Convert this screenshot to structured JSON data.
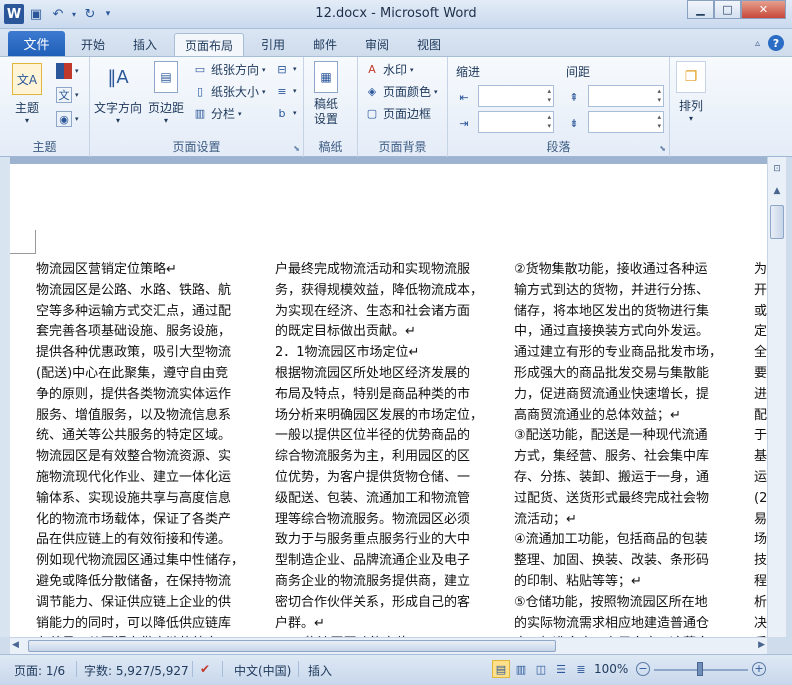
{
  "titlebar": {
    "title": "12.docx - Microsoft Word"
  },
  "tabs": {
    "file": "文件",
    "items": [
      "开始",
      "插入",
      "页面布局",
      "引用",
      "邮件",
      "审阅",
      "视图"
    ],
    "active": "页面布局"
  },
  "ribbon": {
    "theme": {
      "label": "主题",
      "theme_btn": "主题"
    },
    "page_setup": {
      "label": "页面设置",
      "text_direction": "文字方向",
      "margins": "页边距",
      "paper_orientation": "纸张方向",
      "paper_size": "纸张大小",
      "columns": "分栏"
    },
    "manuscript": {
      "label": "稿纸",
      "manuscript_setting": "稿纸\n设置",
      "line1": "稿纸",
      "line2": "设置"
    },
    "page_bg": {
      "label": "页面背景",
      "watermark": "水印",
      "page_color": "页面颜色",
      "page_border": "页面边框"
    },
    "paragraph": {
      "label": "段落",
      "indent": "缩进",
      "spacing": "间距"
    },
    "arrange": {
      "label": "排列",
      "arrange_btn": "排列"
    }
  },
  "document": {
    "col1": [
      "物流园区营销定位策略↵",
      "物流园区是公路、水路、铁路、航",
      "空等多种运输方式交汇点，通过配",
      "套完善各项基础设施、服务设施，",
      "提供各种优惠政策，吸引大型物流",
      "(配送)中心在此聚集，遵守自由竞",
      "争的原则，提供各类物流实体运作",
      "服务、增值服务，以及物流信息系",
      "统、通关等公共服务的特定区域。",
      "物流园区是有效整合物流资源、实",
      "施物流现代化作业、建立一体化运",
      "输体系、实现设施共享与高度信息",
      "化的物流市场载体，保证了各类产",
      "品在供应链上的有效衔接和传递。",
      "例如现代物流园区通过集中性储存，",
      "避免或降低分散储备，在保持物流",
      "调节能力、保证供应链上企业的供",
      "销能力的同时，可以降低供应链库",
      "存总量，从而提高供应链的效率，"
    ],
    "col2": [
      "户最终完成物流活动和实现物流服",
      "务，获得规模效益，降低物流成本，",
      "为实现在经济、生态和社会诸方面",
      "的既定目标做出贡献。↵",
      "2．1物流园区市场定位↵",
      "根据物流园区所处地区经济发展的",
      "布局及特点，特别是商品种类的市",
      "场分析来明确园区发展的市场定位，",
      "一般以提供区位半径的优势商品的",
      "综合物流服务为主，利用园区的区",
      "位优势，为客户提供货物仓储、一",
      "级配送、包装、流通加工和物流管",
      "理等综合物流服务。物流园区必须",
      "致力于与服务重点服务行业的大中",
      "型制造企业、品牌流通企业及电子",
      "商务企业的物流服务提供商，建立",
      "密切合作伙伴关系，形成自己的客",
      "户群。↵",
      "2．2物流园区功能定位↵"
    ],
    "col3": [
      "②货物集散功能，接收通过各种运",
      "输方式到达的货物，并进行分拣、",
      "储存，将本地区发出的货物进行集",
      "中，通过直接换装方式向外发运。",
      "通过建立有形的专业商品批发市场，",
      "形成强大的商品批发交易与集散能",
      "力，促进商贸流通业快速增长，提",
      "高商贸流通业的总体效益；↵",
      "③配送功能，配送是一种现代流通",
      "方式，集经营、服务、社会集中库",
      "存、分拣、装卸、搬运于一身，通",
      "过配货、送货形式最终完成社会物",
      "流活动；↵",
      "④流通加工功能，包括商品的包装",
      "整理、加固、换装、改装、条形码",
      "的印制、粘贴等等；↵",
      "⑤仓储功能，按照物流园区所在地",
      "的实际物流需求相应地建造普通仓",
      "库、标准仓库、专用仓库、冷藏仓"
    ],
    "col4": [
      "为",
      "开",
      "或",
      "定",
      "全",
      "要",
      "进",
      "配",
      "于",
      "基",
      "运",
      "(2",
      "易",
      "场",
      "技",
      "程",
      "析",
      "决",
      "后"
    ]
  },
  "status": {
    "page": "页面: 1/6",
    "words": "字数: 5,927/5,927",
    "lang": "中文(中国)",
    "mode": "插入",
    "zoom": "100%"
  }
}
